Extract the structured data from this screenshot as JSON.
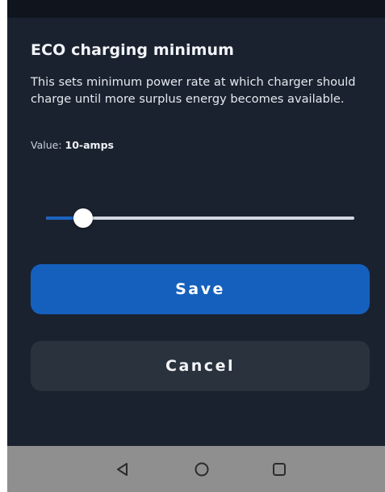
{
  "dialog": {
    "title": "ECO charging minimum",
    "description": "This sets minimum power rate at which charger should charge until more surplus energy becomes available.",
    "value_label": "Value:",
    "value": "10-amps"
  },
  "slider": {
    "position_fraction": 0.12,
    "fill_color": "#1d63c0",
    "track_color": "#d5d9e0"
  },
  "actions": {
    "save_label": "Save",
    "cancel_label": "Cancel"
  },
  "colors": {
    "background": "#1a2230",
    "primary": "#1560bd",
    "secondary_button": "#2a323e",
    "nav_bar": "#8f8f8f"
  },
  "nav": {
    "back_icon": "back-triangle-icon",
    "home_icon": "home-circle-icon",
    "recents_icon": "recents-square-icon"
  }
}
